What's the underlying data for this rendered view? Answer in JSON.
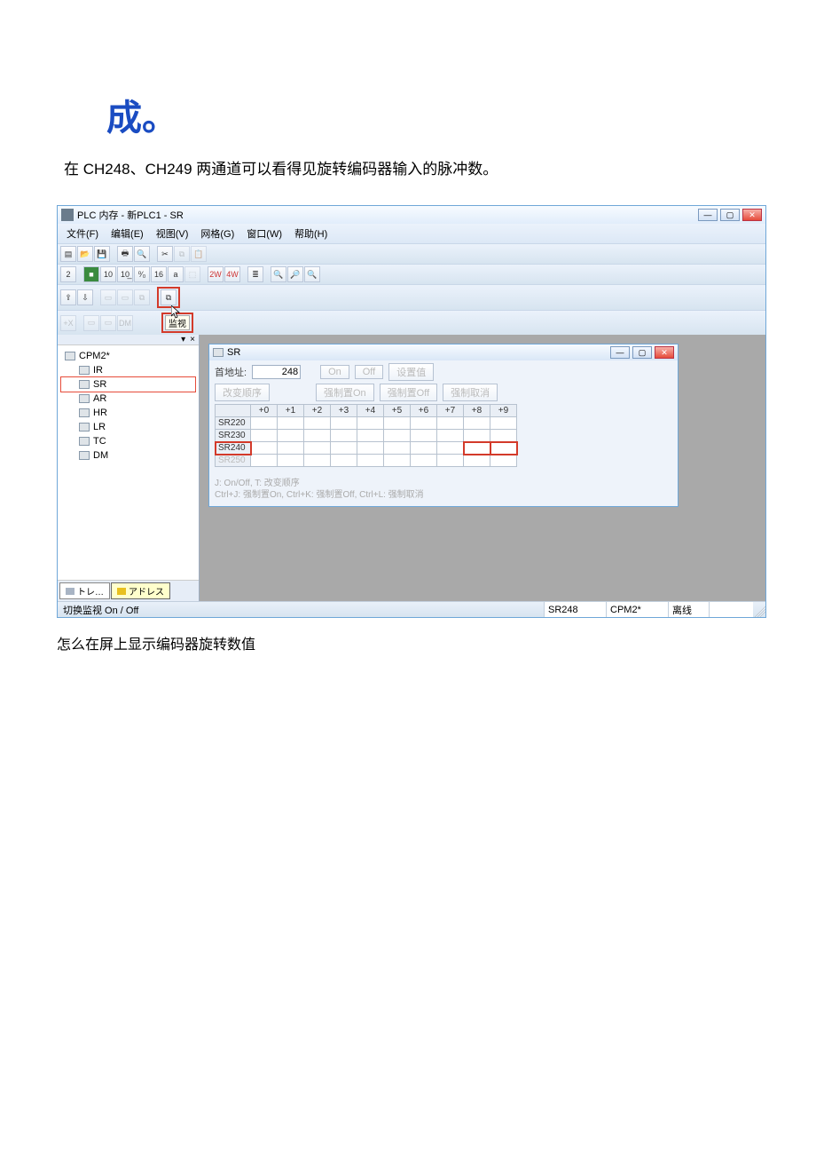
{
  "heading": "成。",
  "desc": "在 CH248、CH249 两通道可以看得见旋转编码器输入的脉冲数。",
  "window": {
    "title": "PLC 内存 - 新PLC1 - SR",
    "menus": [
      "文件(F)",
      "编辑(E)",
      "视图(V)",
      "网格(G)",
      "窗口(W)",
      "帮助(H)"
    ],
    "tb2": [
      "2",
      "■",
      "10",
      "10̲",
      "⁰⁄₀",
      "16",
      "a",
      "⬚",
      "2W",
      "4W",
      "≣",
      "🔍",
      "🔎",
      "🔍"
    ],
    "tb3": [
      "⇪",
      "⇩",
      "▭",
      "▭",
      "⧉",
      "⧉"
    ],
    "tb4": [
      "+X",
      "▭",
      "▭",
      "DM"
    ],
    "monitor_label": "监视"
  },
  "tree": {
    "root": "CPM2*",
    "items": [
      "IR",
      "SR",
      "AR",
      "HR",
      "LR",
      "TC",
      "DM"
    ],
    "selected": "SR"
  },
  "side_tabs": [
    "トレ…",
    "アドレス"
  ],
  "inner": {
    "title": "SR",
    "addr_label": "首地址:",
    "addr_value": "248",
    "btns_row1": [
      "On",
      "Off",
      "设置值"
    ],
    "change_order": "改变顺序",
    "btns_row2": [
      "强制置On",
      "强制置Off",
      "强制取消"
    ],
    "col_headers": [
      "+0",
      "+1",
      "+2",
      "+3",
      "+4",
      "+5",
      "+6",
      "+7",
      "+8",
      "+9"
    ],
    "row_labels": [
      "SR220",
      "SR230",
      "SR240",
      "SR250"
    ],
    "highlight_row": 2,
    "highlight_cols": [
      8,
      9
    ],
    "hint1": "J: On/Off,  T: 改变顺序",
    "hint2": "Ctrl+J: 强制置On,  Ctrl+K: 强制置Off,  Ctrl+L: 强制取消"
  },
  "status": {
    "left": "切换监视 On / Off",
    "cells": [
      "SR248",
      "CPM2*",
      "离线",
      ""
    ]
  },
  "caption": "怎么在屏上显示编码器旋转数值"
}
